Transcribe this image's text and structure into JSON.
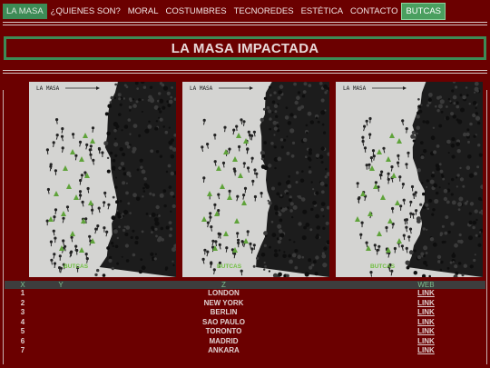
{
  "nav": {
    "items": [
      {
        "label": "LA MASA"
      },
      {
        "label": "¿QUIENES SON?"
      },
      {
        "label": "MORAL"
      },
      {
        "label": "COSTUMBRES"
      },
      {
        "label": "TECNOREDES"
      },
      {
        "label": "ESTÉTICA"
      },
      {
        "label": "CONTACTO"
      },
      {
        "label": "BUTCAS"
      }
    ]
  },
  "page_title": "LA MASA IMPACTADA",
  "images": [
    {
      "caption_top": "LA MASA",
      "caption_bottom": "BUTCAS"
    },
    {
      "caption_top": "LA MASA",
      "caption_bottom": "BUTCAS"
    },
    {
      "caption_top": "LA MASA",
      "caption_bottom": "BUTCAS"
    }
  ],
  "table": {
    "headers": [
      "X",
      "Y",
      "Z",
      "WEB"
    ],
    "rows": [
      {
        "x": "1",
        "y": "",
        "z": "LONDON",
        "web": "LINK"
      },
      {
        "x": "2",
        "y": "",
        "z": "NEW YORK",
        "web": "LINK"
      },
      {
        "x": "3",
        "y": "",
        "z": "BERLIN",
        "web": "LINK"
      },
      {
        "x": "4",
        "y": "",
        "z": "SAO PAULO",
        "web": "LINK"
      },
      {
        "x": "5",
        "y": "",
        "z": "TORONTO",
        "web": "LINK"
      },
      {
        "x": "6",
        "y": "",
        "z": "MADRID",
        "web": "LINK"
      },
      {
        "x": "7",
        "y": "",
        "z": "ANKARA",
        "web": "LINK"
      }
    ]
  },
  "colors": {
    "background": "#6b0000",
    "accent_green": "#3d8b56",
    "header_gray": "#3d3d3d",
    "triangle_green": "#5fa33a"
  }
}
